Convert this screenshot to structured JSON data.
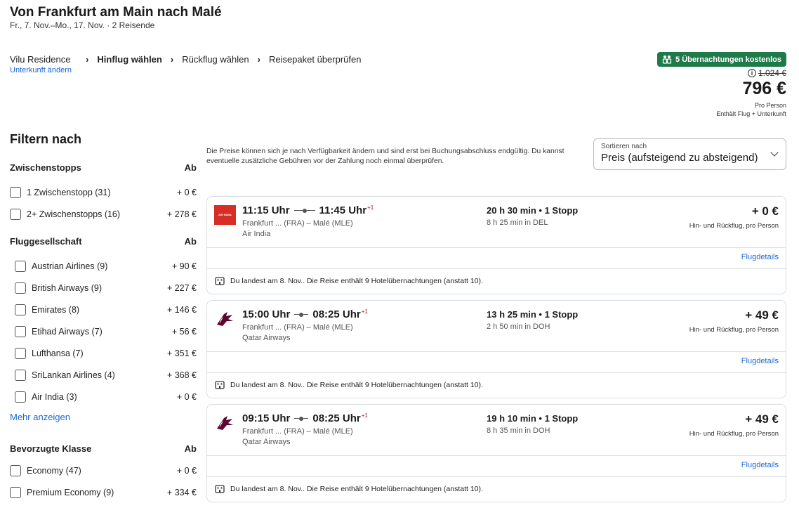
{
  "header": {
    "title": "Von Frankfurt am Main nach Malé",
    "subtitle": "Fr., 7. Nov.–Mo., 17. Nov. · 2 Reisende"
  },
  "breadcrumb": {
    "hotel": "Vilu Residence",
    "change_link": "Unterkunft ändern",
    "step_outbound": "Hinflug wählen",
    "step_return": "Rückflug wählen",
    "step_review": "Reisepaket überprüfen"
  },
  "price_summary": {
    "promo_badge": "5 Übernachtungen kostenlos",
    "old_price": "1.024 €",
    "price": "796 €",
    "per_person": "Pro Person",
    "includes": "Enthält Flug + Unterkunft"
  },
  "filters": {
    "title": "Filtern nach",
    "stops": {
      "heading": "Zwischenstopps",
      "from_label": "Ab",
      "options": [
        {
          "label": "1 Zwischenstopp (31)",
          "price": "+ 0 €"
        },
        {
          "label": "2+ Zwischenstopps (16)",
          "price": "+ 278 €"
        }
      ]
    },
    "airlines": {
      "heading": "Fluggesellschaft",
      "from_label": "Ab",
      "options": [
        {
          "label": "Austrian Airlines (9)",
          "price": "+ 90 €"
        },
        {
          "label": "British Airways (9)",
          "price": "+ 227 €"
        },
        {
          "label": "Emirates (8)",
          "price": "+ 146 €"
        },
        {
          "label": "Etihad Airways (7)",
          "price": "+ 56 €"
        },
        {
          "label": "Lufthansa (7)",
          "price": "+ 351 €"
        },
        {
          "label": "SriLankan Airlines (4)",
          "price": "+ 368 €"
        },
        {
          "label": "Air India (3)",
          "price": "+ 0 €"
        }
      ],
      "more": "Mehr anzeigen"
    },
    "cabin": {
      "heading": "Bevorzugte Klasse",
      "from_label": "Ab",
      "options": [
        {
          "label": "Economy (47)",
          "price": "+ 0 €"
        },
        {
          "label": "Premium Economy (9)",
          "price": "+ 334 €"
        }
      ]
    }
  },
  "notice": "Die Preise können sich je nach Verfügbarkeit ändern und sind erst bei Buchungsabschluss endgültig. Du kannst eventuelle zusätzliche Gebühren vor der Zahlung noch einmal überprüfen.",
  "sort": {
    "label": "Sortieren nach",
    "value": "Preis (aufsteigend zu absteigend)"
  },
  "flights": [
    {
      "logo": "air-india-logo",
      "logo_text": "AIR INDIA",
      "depart": "11:15 Uhr",
      "arrive": "11:45 Uhr",
      "day_offset": "+1",
      "airports": "Frankfurt ... (FRA) – Malé (MLE)",
      "airline": "Air India",
      "duration": "20 h 30 min • 1 Stopp",
      "layover": "8 h 25 min in DEL",
      "price": "+ 0 €",
      "price_note": "Hin- und Rückflug, pro Person",
      "details": "Flugdetails",
      "hotel_note": "Du landest am 8. Nov.. Die Reise enthält 9 Hotelübernachtungen (anstatt 10)."
    },
    {
      "logo": "qatar-airways-logo",
      "logo_text": "",
      "depart": "15:00 Uhr",
      "arrive": "08:25 Uhr",
      "day_offset": "+1",
      "airports": "Frankfurt ... (FRA) – Malé (MLE)",
      "airline": "Qatar Airways",
      "duration": "13 h 25 min • 1 Stopp",
      "layover": "2 h 50 min in DOH",
      "price": "+ 49 €",
      "price_note": "Hin- und Rückflug, pro Person",
      "details": "Flugdetails",
      "hotel_note": "Du landest am 8. Nov.. Die Reise enthält 9 Hotelübernachtungen (anstatt 10)."
    },
    {
      "logo": "qatar-airways-logo",
      "logo_text": "",
      "depart": "09:15 Uhr",
      "arrive": "08:25 Uhr",
      "day_offset": "+1",
      "airports": "Frankfurt ... (FRA) – Malé (MLE)",
      "airline": "Qatar Airways",
      "duration": "19 h 10 min • 1 Stopp",
      "layover": "8 h 35 min in DOH",
      "price": "+ 49 €",
      "price_note": "Hin- und Rückflug, pro Person",
      "details": "Flugdetails",
      "hotel_note": "Du landest am 8. Nov.. Die Reise enthält 9 Hotelübernachtungen (anstatt 10)."
    }
  ],
  "colors": {
    "accent_link": "#1a66d6",
    "promo_green": "#1f7a4a",
    "air_india_red": "#d62d26",
    "qatar_maroon": "#5c0632"
  }
}
